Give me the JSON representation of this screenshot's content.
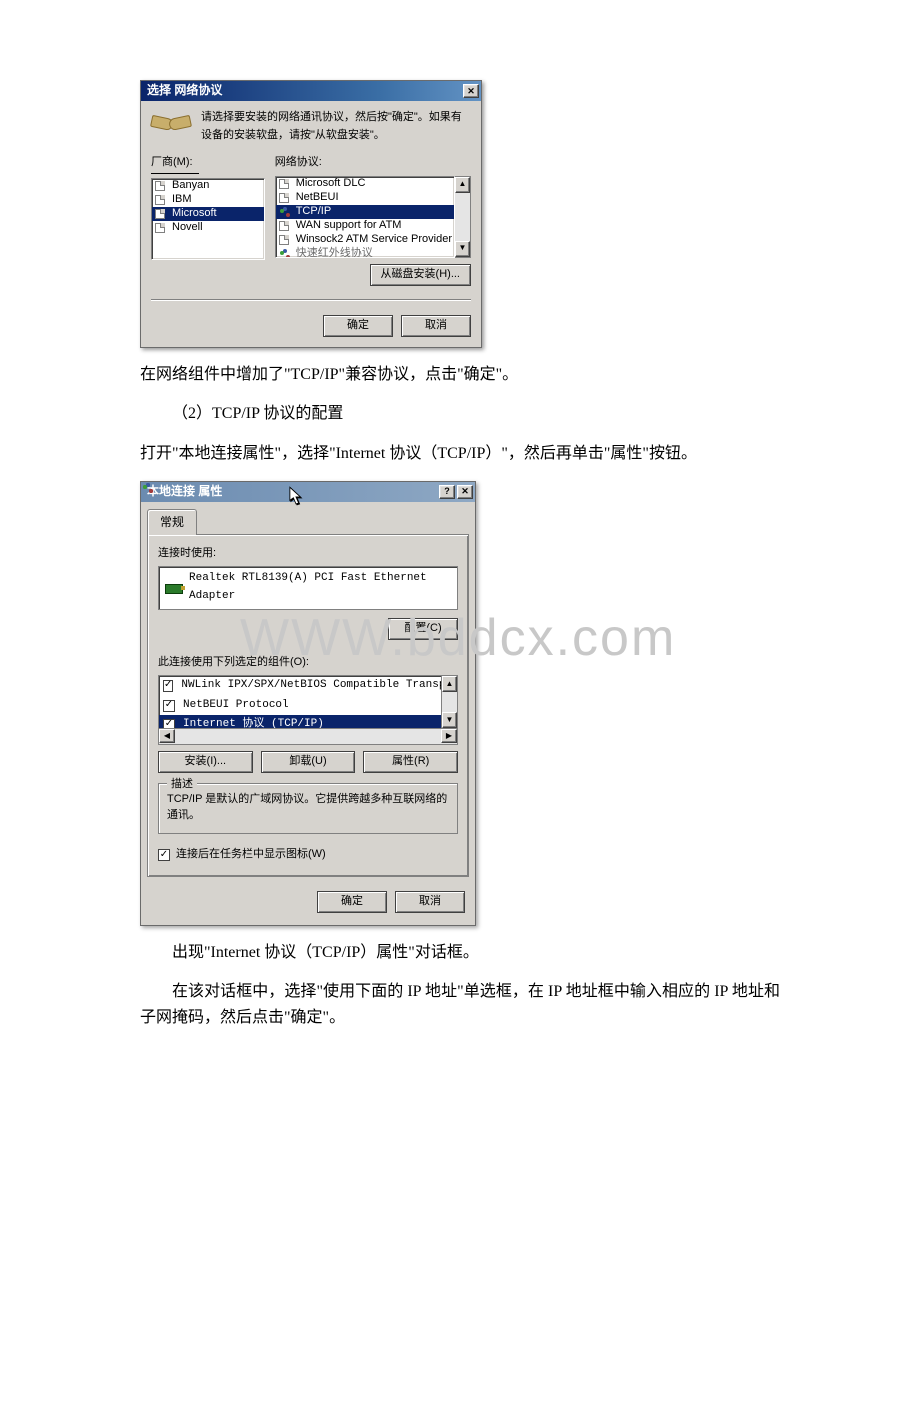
{
  "dialog1": {
    "title": "选择 网络协议",
    "close": "✕",
    "message": "请选择要安装的网络通讯协议，然后按\"确定\"。如果有设备的安装软盘，请按\"从软盘安装\"。",
    "vendor_label": "厂商(M):",
    "protocol_label": "网络协议:",
    "vendors": [
      "Banyan",
      "IBM",
      "Microsoft",
      "Novell"
    ],
    "vendor_selected": "Microsoft",
    "protocols": [
      {
        "label": "Microsoft DLC",
        "type": "page"
      },
      {
        "label": "NetBEUI",
        "type": "page"
      },
      {
        "label": "TCP/IP",
        "type": "net",
        "selected": true
      },
      {
        "label": "WAN support for ATM",
        "type": "page"
      },
      {
        "label": "Winsock2 ATM Service Provider",
        "type": "page"
      },
      {
        "label": "快速红外线协议",
        "type": "net",
        "gray": true
      }
    ],
    "from_disk_btn": "从磁盘安装(H)...",
    "ok_btn": "确定",
    "cancel_btn": "取消",
    "scroll_up": "▲",
    "scroll_down": "▼"
  },
  "para1": "在网络组件中增加了\"TCP/IP\"兼容协议，点击\"确定\"。",
  "para2": "（2）TCP/IP 协议的配置",
  "para3": "打开\"本地连接属性\"，选择\"Internet 协议（TCP/IP）\"，然后再单击\"属性\"按钮。",
  "watermark": "WWW.bddcx.com",
  "dialog2": {
    "title": "本地连接 属性",
    "help": "?",
    "close": "✕",
    "tab_general": "常规",
    "connect_using_label": "连接时使用:",
    "adapter": "Realtek RTL8139(A) PCI Fast Ethernet Adapter",
    "configure_btn": "配置(C)",
    "components_label": "此连接使用下列选定的组件(O):",
    "scroll_up": "▲",
    "scroll_down": "▼",
    "scroll_left": "◀",
    "scroll_right": "▶",
    "components": [
      {
        "label": "NWLink IPX/SPX/NetBIOS Compatible Transport",
        "checked": true
      },
      {
        "label": "NetBEUI Protocol",
        "checked": true
      },
      {
        "label": "Internet 协议 (TCP/IP)",
        "checked": true,
        "selected": true
      }
    ],
    "install_btn": "安装(I)...",
    "uninstall_btn": "卸载(U)",
    "properties_btn": "属性(R)",
    "desc_title": "描述",
    "desc_text": "TCP/IP 是默认的广域网协议。它提供跨越多种互联网络的通讯。",
    "tray_checkbox": "连接后在任务栏中显示图标(W)",
    "ok_btn": "确定",
    "cancel_btn": "取消"
  },
  "para4": "出现\"Internet 协议（TCP/IP）属性\"对话框。",
  "para5": "在该对话框中，选择\"使用下面的 IP 地址\"单选框，在 IP 地址框中输入相应的 IP 地址和子网掩码，然后点击\"确定\"。"
}
